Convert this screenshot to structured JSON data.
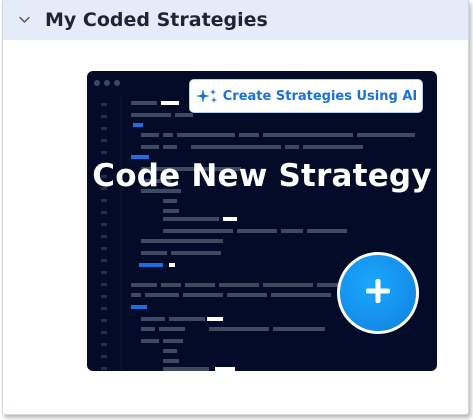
{
  "section": {
    "title": "My Coded Strategies",
    "toggle_icon": "chevron-down-icon"
  },
  "card": {
    "title": "Code New Strategy",
    "ai_button": {
      "label": "Create Strategies Using AI",
      "icon": "sparkles-icon"
    },
    "add_button": {
      "icon": "plus-icon"
    }
  },
  "colors": {
    "header_bg": "#e4ecf9",
    "card_bg": "#030b29",
    "accent_blue": "#1972d8",
    "add_button_blue": "#1592ec"
  }
}
